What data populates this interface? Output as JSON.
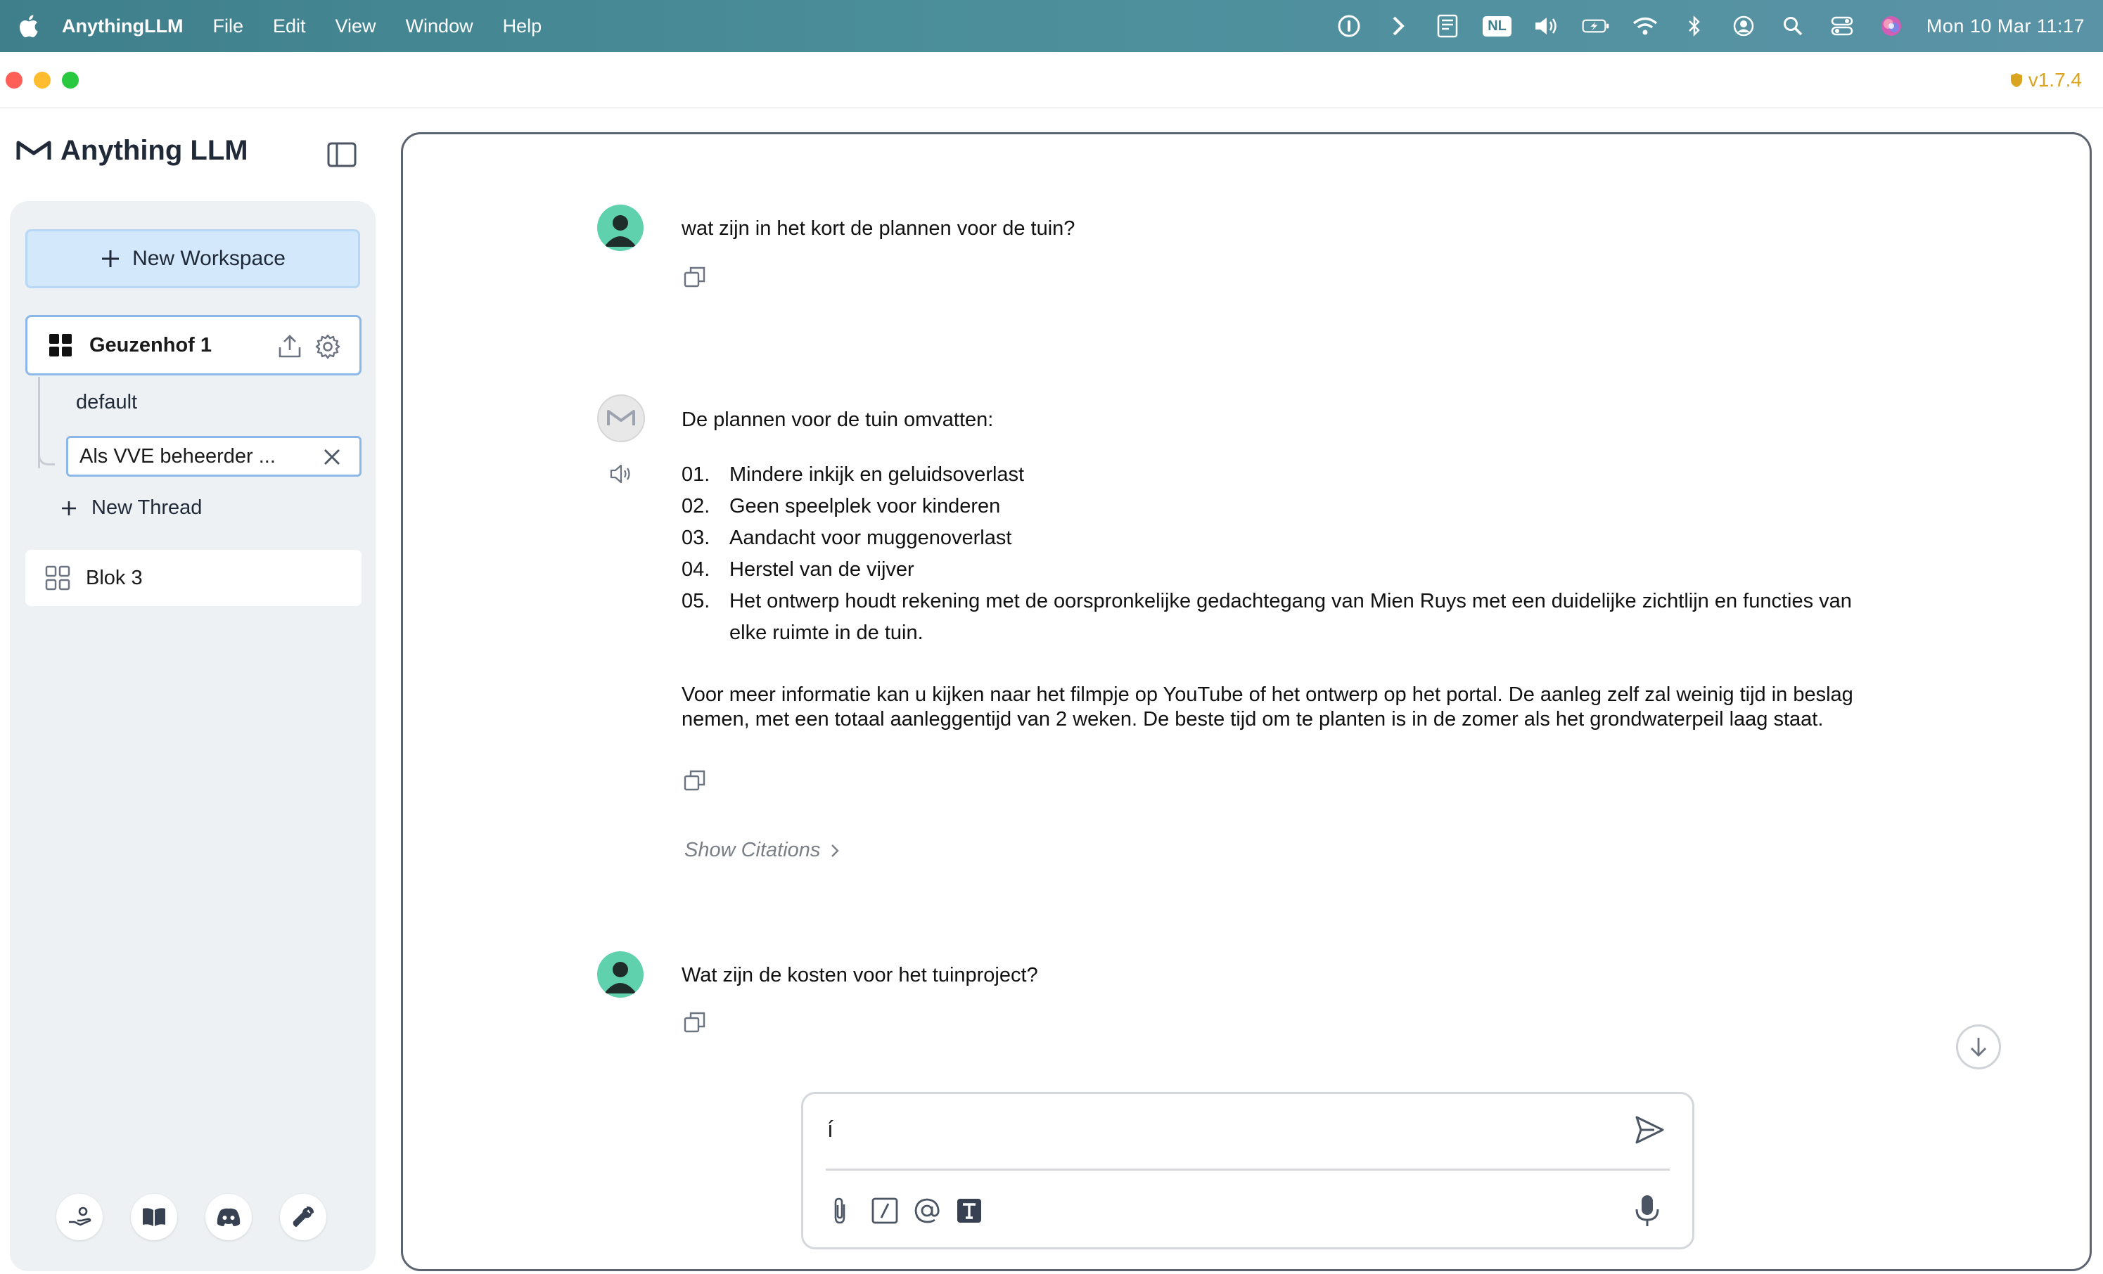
{
  "menubar": {
    "app_name": "AnythingLLM",
    "menus": [
      "File",
      "Edit",
      "View",
      "Window",
      "Help"
    ],
    "tray_icons": [
      "onepassword-icon",
      "chevron-icon",
      "ebook-icon",
      "keyboard-layout-icon",
      "volume-icon",
      "battery-icon",
      "wifi-icon",
      "bluetooth-icon",
      "user-icon",
      "spotlight-icon",
      "control-center-icon",
      "siri-icon"
    ],
    "keyboard_layout": "NL",
    "clock": "Mon 10 Mar  11:17"
  },
  "window": {
    "version": "v1.7.4",
    "version_color": "#d9a521"
  },
  "sidebar": {
    "brand": "Anything LLM",
    "new_workspace_label": "New Workspace",
    "active_workspace": {
      "name": "Geuzenhof 1",
      "threads": [
        {
          "name": "default"
        },
        {
          "name": "Als VVE beheerder ..."
        }
      ],
      "new_thread_label": "New Thread"
    },
    "other_workspaces": [
      {
        "name": "Blok 3"
      }
    ],
    "footer_icons": [
      "community-hub-icon",
      "docs-book-icon",
      "discord-icon",
      "settings-wrench-icon"
    ]
  },
  "chat": {
    "messages": [
      {
        "role": "user",
        "text": "wat zijn in het kort de plannen voor de tuin?"
      },
      {
        "role": "assistant",
        "intro": "De plannen voor de tuin omvatten:",
        "list": [
          {
            "num": "01.",
            "text": "Mindere inkijk en geluidsoverlast"
          },
          {
            "num": "02.",
            "text": "Geen speelplek voor kinderen"
          },
          {
            "num": "03.",
            "text": "Aandacht voor muggenoverlast"
          },
          {
            "num": "04.",
            "text": "Herstel van de vijver"
          },
          {
            "num": "05.",
            "text": "Het ontwerp houdt rekening met de oorspronkelijke gedachtegang van Mien Ruys met een duidelijke zichtlijn en functies van elke ruimte in de tuin."
          }
        ],
        "paragraph": "Voor meer informatie kan u kijken naar het filmpje op YouTube of het ontwerp op het portal. De aanleg zelf zal weinig tijd in beslag nemen, met een totaal aanleggentijd van 2 weken. De beste tijd om te planten is in de zomer als het grondwaterpeil laag staat.",
        "citations_label": "Show Citations"
      },
      {
        "role": "user",
        "text": "Wat zijn de kosten voor het tuinproject?"
      }
    ],
    "composer": {
      "value": "í",
      "placeholder": ""
    }
  },
  "colors": {
    "accent_light": "#d3e8fb",
    "accent_border": "#8bb8e8",
    "user_avatar": "#5fd1ad"
  }
}
